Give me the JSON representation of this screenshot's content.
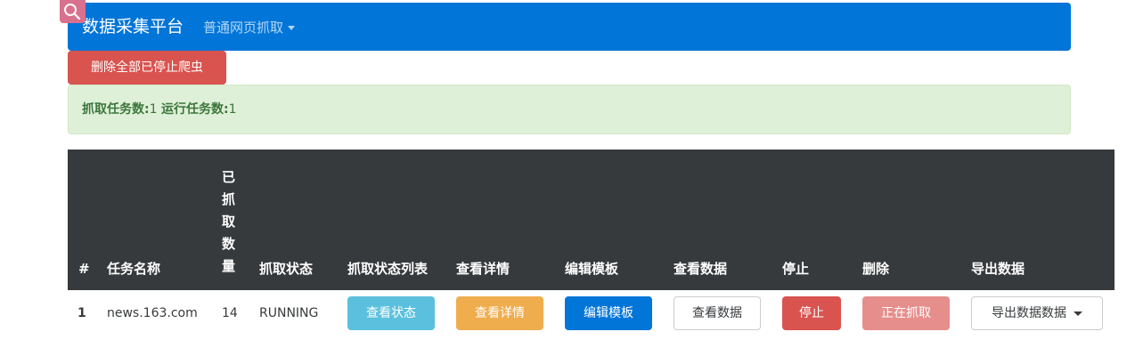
{
  "navbar": {
    "brand": "数据采集平台",
    "dropdown_label": "普通网页抓取",
    "brand_color": "#0275d8"
  },
  "actions": {
    "delete_all_label": "删除全部已停止爬虫"
  },
  "alert": {
    "crawl_label": "抓取任务数:",
    "crawl_count": "1",
    "running_label": "运行任务数:",
    "running_count": "1"
  },
  "table": {
    "headers": [
      "#",
      "任务名称",
      "已抓取数量",
      "抓取状态",
      "抓取状态列表",
      "查看详情",
      "编辑模板",
      "查看数据",
      "停止",
      "删除",
      "导出数据"
    ],
    "rows": [
      {
        "id": "1",
        "name": "news.163.com",
        "count": "14",
        "status": "RUNNING",
        "view_status_label": "查看状态",
        "view_details_label": "查看详情",
        "edit_template_label": "编辑模板",
        "view_data_label": "查看数据",
        "stop_label": "停止",
        "delete_label": "正在抓取",
        "export_label": "导出数据数据"
      }
    ]
  },
  "icons": {
    "top_left_badge": "search-icon"
  }
}
